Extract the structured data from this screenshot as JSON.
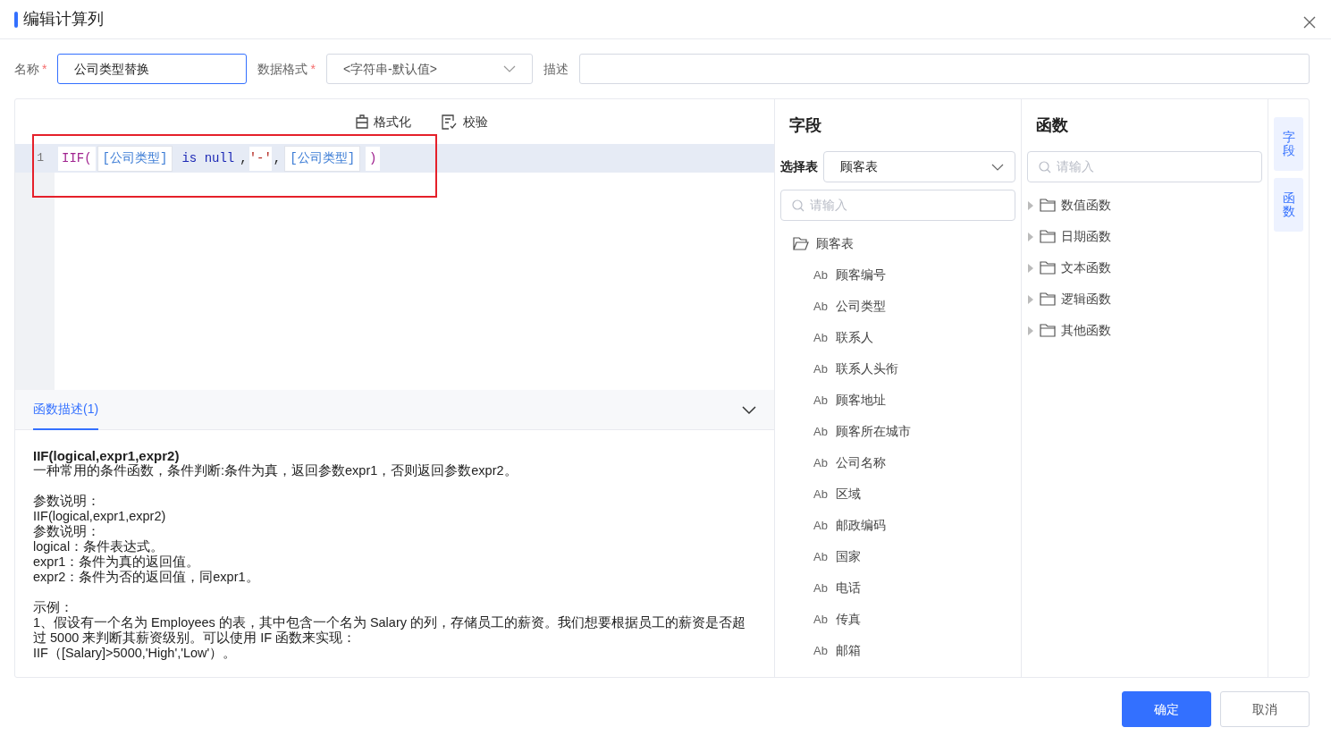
{
  "dialog": {
    "title": "编辑计算列"
  },
  "form": {
    "name_label": "名称",
    "name_required": true,
    "name_value": "公司类型替换",
    "format_label": "数据格式",
    "format_required": true,
    "format_value": "<字符串-默认值>",
    "desc_label": "描述",
    "required_mark": "*"
  },
  "toolbar": [
    {
      "label": "格式化",
      "kind": "format"
    },
    {
      "label": "校验",
      "kind": "verify"
    }
  ],
  "editor": {
    "line_number": "1",
    "tokens": [
      {
        "kind": "func",
        "text": "IIF("
      },
      {
        "kind": "field",
        "text": "[公司类型]"
      },
      {
        "kind": "keyword",
        "text": "is null"
      },
      {
        "kind": "punct",
        "text": ","
      },
      {
        "kind": "string",
        "text": "'-'"
      },
      {
        "kind": "punct",
        "text": ","
      },
      {
        "kind": "field",
        "text": "[公司类型]"
      },
      {
        "kind": "func",
        "text": ")"
      }
    ]
  },
  "description": {
    "tab": "函数描述(1)",
    "expanded": true,
    "title": "IIF(logical,expr1,expr2)",
    "paragraphs": [
      [
        "一种常用的条件函数，条件判断:条件为真，返回参数expr1，否则返回参数expr2。"
      ],
      [
        "参数说明：",
        "IIF(logical,expr1,expr2)",
        "参数说明：",
        "logical：条件表达式。",
        "expr1：条件为真的返回值。",
        "expr2：条件为否的返回值，同expr1。"
      ],
      [
        "示例：",
        "1、假设有一个名为 Employees 的表，其中包含一个名为 Salary 的列，存储员工的薪资。我们想要根据员工的薪资是否超过 5000 来判断其薪资级别。可以使用 IF 函数来实现：",
        "IIF（[Salary]>5000,'High','Low'）。"
      ]
    ]
  },
  "fields_panel": {
    "title": "字段",
    "table_label": "选择表",
    "table_value": "顾客表",
    "search_placeholder": "请输入",
    "tree": [
      {
        "label": "顾客表",
        "expanded": true,
        "children": [
          {
            "label": "顾客编号",
            "type": "Ab"
          },
          {
            "label": "公司类型",
            "type": "Ab"
          },
          {
            "label": "联系人",
            "type": "Ab"
          },
          {
            "label": "联系人头衔",
            "type": "Ab"
          },
          {
            "label": "顾客地址",
            "type": "Ab"
          },
          {
            "label": "顾客所在城市",
            "type": "Ab"
          },
          {
            "label": "公司名称",
            "type": "Ab"
          },
          {
            "label": "区域",
            "type": "Ab"
          },
          {
            "label": "邮政编码",
            "type": "Ab"
          },
          {
            "label": "国家",
            "type": "Ab"
          },
          {
            "label": "电话",
            "type": "Ab"
          },
          {
            "label": "传真",
            "type": "Ab"
          },
          {
            "label": "邮箱",
            "type": "Ab"
          }
        ]
      }
    ]
  },
  "functions_panel": {
    "title": "函数",
    "search_placeholder": "请输入",
    "groups": [
      {
        "label": "数值函数",
        "expanded": false
      },
      {
        "label": "日期函数",
        "expanded": false
      },
      {
        "label": "文本函数",
        "expanded": false
      },
      {
        "label": "逻辑函数",
        "expanded": false
      },
      {
        "label": "其他函数",
        "expanded": false
      }
    ]
  },
  "side_tabs": [
    {
      "label": "字段"
    },
    {
      "label": "函数"
    }
  ],
  "buttons": [
    {
      "label": "确定",
      "kind": "primary"
    },
    {
      "label": "取消",
      "kind": "secondary"
    }
  ]
}
